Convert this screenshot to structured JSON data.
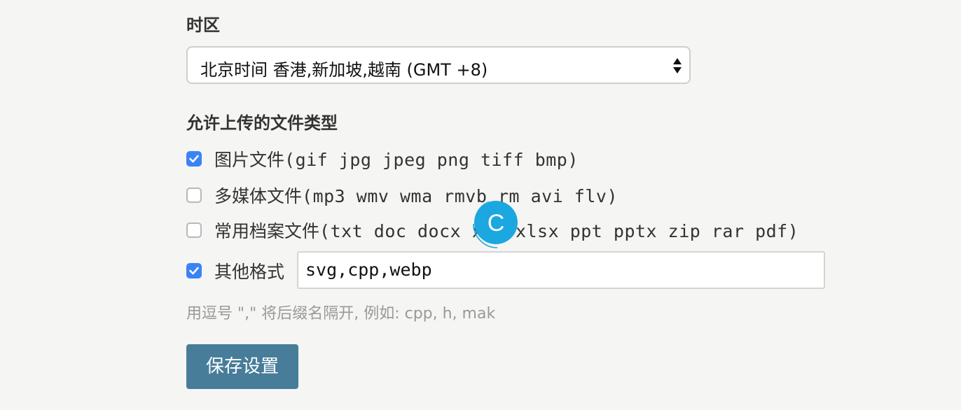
{
  "timezone": {
    "title": "时区",
    "selected": "北京时间 香港,新加坡,越南 (GMT +8)"
  },
  "file_types": {
    "title": "允许上传的文件类型",
    "options": [
      {
        "label": "图片文件",
        "extensions": "(gif jpg jpeg png tiff bmp)",
        "checked": true
      },
      {
        "label": "多媒体文件",
        "extensions": "(mp3 wmv wma rmvb rm avi flv)",
        "checked": false
      },
      {
        "label": "常用档案文件",
        "extensions": "(txt doc docx xls xlsx ppt pptx zip rar pdf)",
        "checked": false
      }
    ],
    "other": {
      "label": "其他格式",
      "checked": true,
      "value": "svg,cpp,webp"
    },
    "hint": "用逗号 \",\" 将后缀名隔开, 例如: cpp, h, mak"
  },
  "save_button": "保存设置",
  "cursor_badge": "C",
  "colors": {
    "accent": "#3b82f6",
    "button": "#477d99",
    "cursor": "#1ba7e0"
  }
}
